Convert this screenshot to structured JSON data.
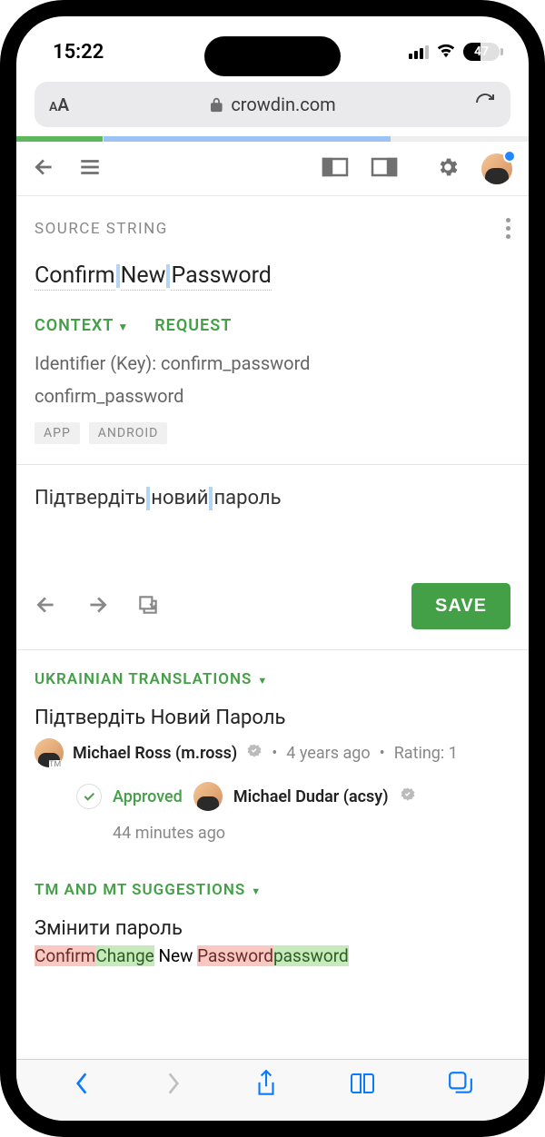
{
  "status_bar": {
    "time": "15:22",
    "battery": "47"
  },
  "browser": {
    "url": "crowdin.com"
  },
  "source": {
    "header": "SOURCE STRING",
    "words": [
      "Confirm",
      "New",
      "Password"
    ],
    "context_label": "CONTEXT",
    "request_label": "REQUEST",
    "identifier_line": "Identifier (Key): confirm_password",
    "identifier_value": "confirm_password",
    "tags": [
      "APP",
      "ANDROID"
    ]
  },
  "translation": {
    "words": [
      "Підтвердіть",
      "новий",
      "пароль"
    ],
    "save_label": "SAVE"
  },
  "translations_section": {
    "header": "UKRAINIAN TRANSLATIONS",
    "suggestion_text": "Підтвердіть Новий Пароль",
    "author": "Michael Ross (m.ross)",
    "age": "4 years ago",
    "rating_label": "Rating: 1",
    "approved_label": "Approved",
    "approver": "Michael Dudar (acsy)",
    "approved_ago": "44 minutes ago"
  },
  "tm_section": {
    "header": "TM AND MT SUGGESTIONS",
    "suggestion": "Змінити пароль",
    "diff_del1": "Confirm",
    "diff_ins1": "Change",
    "diff_mid": " New ",
    "diff_del2": "Password",
    "diff_ins2": "password"
  }
}
